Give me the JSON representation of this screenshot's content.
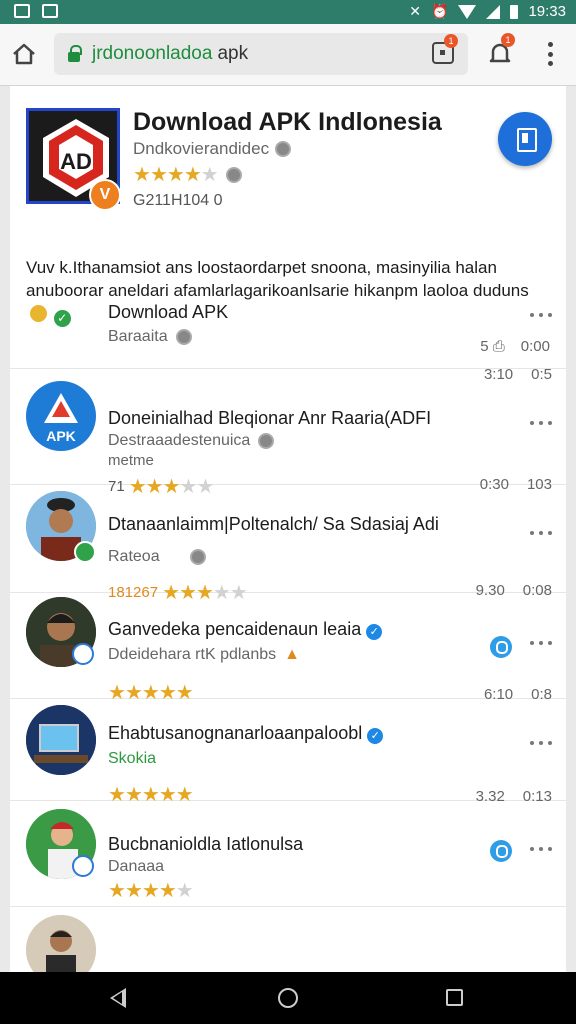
{
  "status_bar": {
    "time": "19:33"
  },
  "browser": {
    "url_host": "jrdonoonladoa",
    "url_path": "apk",
    "tabs_badge": "1",
    "notif_badge": "1"
  },
  "hero": {
    "title": "Download APK Indlonesia",
    "subtitle": "Dndkovierandidec",
    "rating_stars": 3.5,
    "meta": "G211H104  0",
    "badge_letter": "V",
    "description": "Vuv k.Ithanamsiot ans loostaordarpet snoona, masinyilia halan anuboorar aneldari afamlarlagarikoanlsarie hikanpm laoloa duduns",
    "count_left": "5",
    "count_right": "0:00"
  },
  "items": [
    {
      "title": "Download APK",
      "subtitle": "Baraaita",
      "nums": [
        "3:10",
        "0:5"
      ],
      "avatar_label": "APK"
    },
    {
      "title": "Doneinialhad Bleqionar Anr Raaria(ADFI",
      "subtitle": "Destraaadestenuica",
      "subtitle2": "metme",
      "rating_count": "71",
      "rating_stars": 2.5,
      "nums": [
        "0:30",
        "103"
      ]
    },
    {
      "title": "Dtanaanlaimm|Poltenalch/ Sa Sdasiaj Adi",
      "subtitle": "Rateoa",
      "rating_count": "181267",
      "rating_stars": 2.5,
      "nums": [
        "9.30",
        "0:08"
      ]
    },
    {
      "title": "Ganvedeka pencaidenaun leaia",
      "subtitle": "Ddeidehara rtK pdlanbs",
      "rating_stars": 5,
      "nums": [
        "6:10",
        "0:8"
      ]
    },
    {
      "title": "Ehabtusanognanarloaanpaloobl",
      "subtitle": "Skokia",
      "rating_stars": 4.5,
      "nums": [
        "3.32",
        "0:13"
      ]
    },
    {
      "title": "Bucbnanioldla Iatlonulsa",
      "subtitle": "Danaaa",
      "rating_stars": 4
    }
  ]
}
